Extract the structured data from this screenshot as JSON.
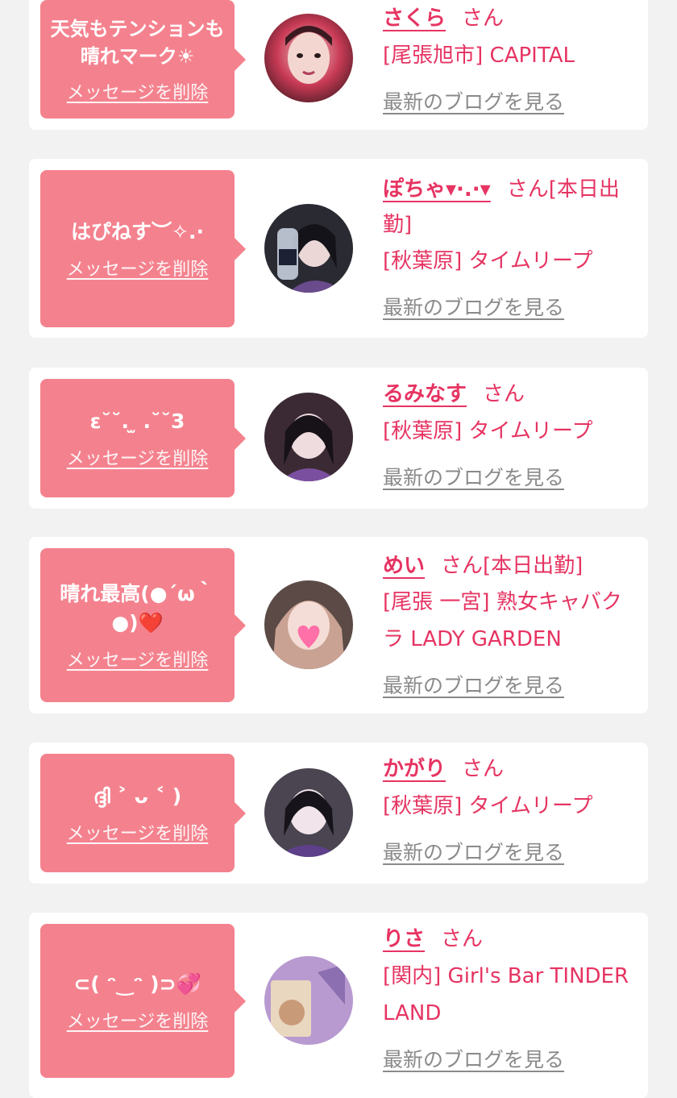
{
  "entries": [
    {
      "message": "天気もテンションも晴れマーク☀",
      "delete_label": "メッセージを削除",
      "name": "さくら",
      "suffix": "さん",
      "extra": "",
      "shop": "[尾張旭市] CAPITAL",
      "blog_label": "最新のブログを見る",
      "avatar_colors": [
        "#c83a55",
        "#f0c9c8",
        "#5a1f2a"
      ]
    },
    {
      "message": "はぴねす︶✧.·",
      "delete_label": "メッセージを削除",
      "name": "ぽちゃ▾·.·▾",
      "suffix": "さん",
      "extra": "[本日出勤]",
      "shop": "[秋葉原] タイムリープ",
      "blog_label": "最新のブログを見る",
      "avatar_colors": [
        "#2a2a33",
        "#d9c7d6",
        "#6a4b8c"
      ]
    },
    {
      "message": "ε˘˘.  ̫ .˘˘3",
      "delete_label": "メッセージを削除",
      "name": "るみなす",
      "suffix": "さん",
      "extra": "",
      "shop": "[秋葉原] タイムリープ",
      "blog_label": "最新のブログを見る",
      "avatar_colors": [
        "#3b2a33",
        "#e9d3d8",
        "#7b4fa0"
      ]
    },
    {
      "message": "晴れ最高(●´ω｀●)❤️",
      "delete_label": "メッセージを削除",
      "name": "めい",
      "suffix": "さん",
      "extra": "[本日出勤]",
      "shop": "[尾張 一宮] 熟女キャバクラ LADY GARDEN",
      "blog_label": "最新のブログを見る",
      "avatar_colors": [
        "#5b4a46",
        "#f1d9d5",
        "#ff6fa8"
      ]
    },
    {
      "message": "ദ്ദി ˃ ᴗ ˂ )",
      "delete_label": "メッセージを削除",
      "name": "かがり",
      "suffix": "さん",
      "extra": "",
      "shop": "[秋葉原] タイムリープ",
      "blog_label": "最新のブログを見る",
      "avatar_colors": [
        "#4a4550",
        "#efe4ea",
        "#5e3f8a"
      ]
    },
    {
      "message": "⊂( ᵔ‿ᵔ )⊃💞",
      "delete_label": "メッセージを削除",
      "name": "りさ",
      "suffix": "さん",
      "extra": "",
      "shop": "[関内] Girl's Bar TINDER LAND",
      "blog_label": "最新のブログを見る",
      "avatar_colors": [
        "#b89ad0",
        "#ead7c0",
        "#8c6fb0"
      ]
    }
  ]
}
